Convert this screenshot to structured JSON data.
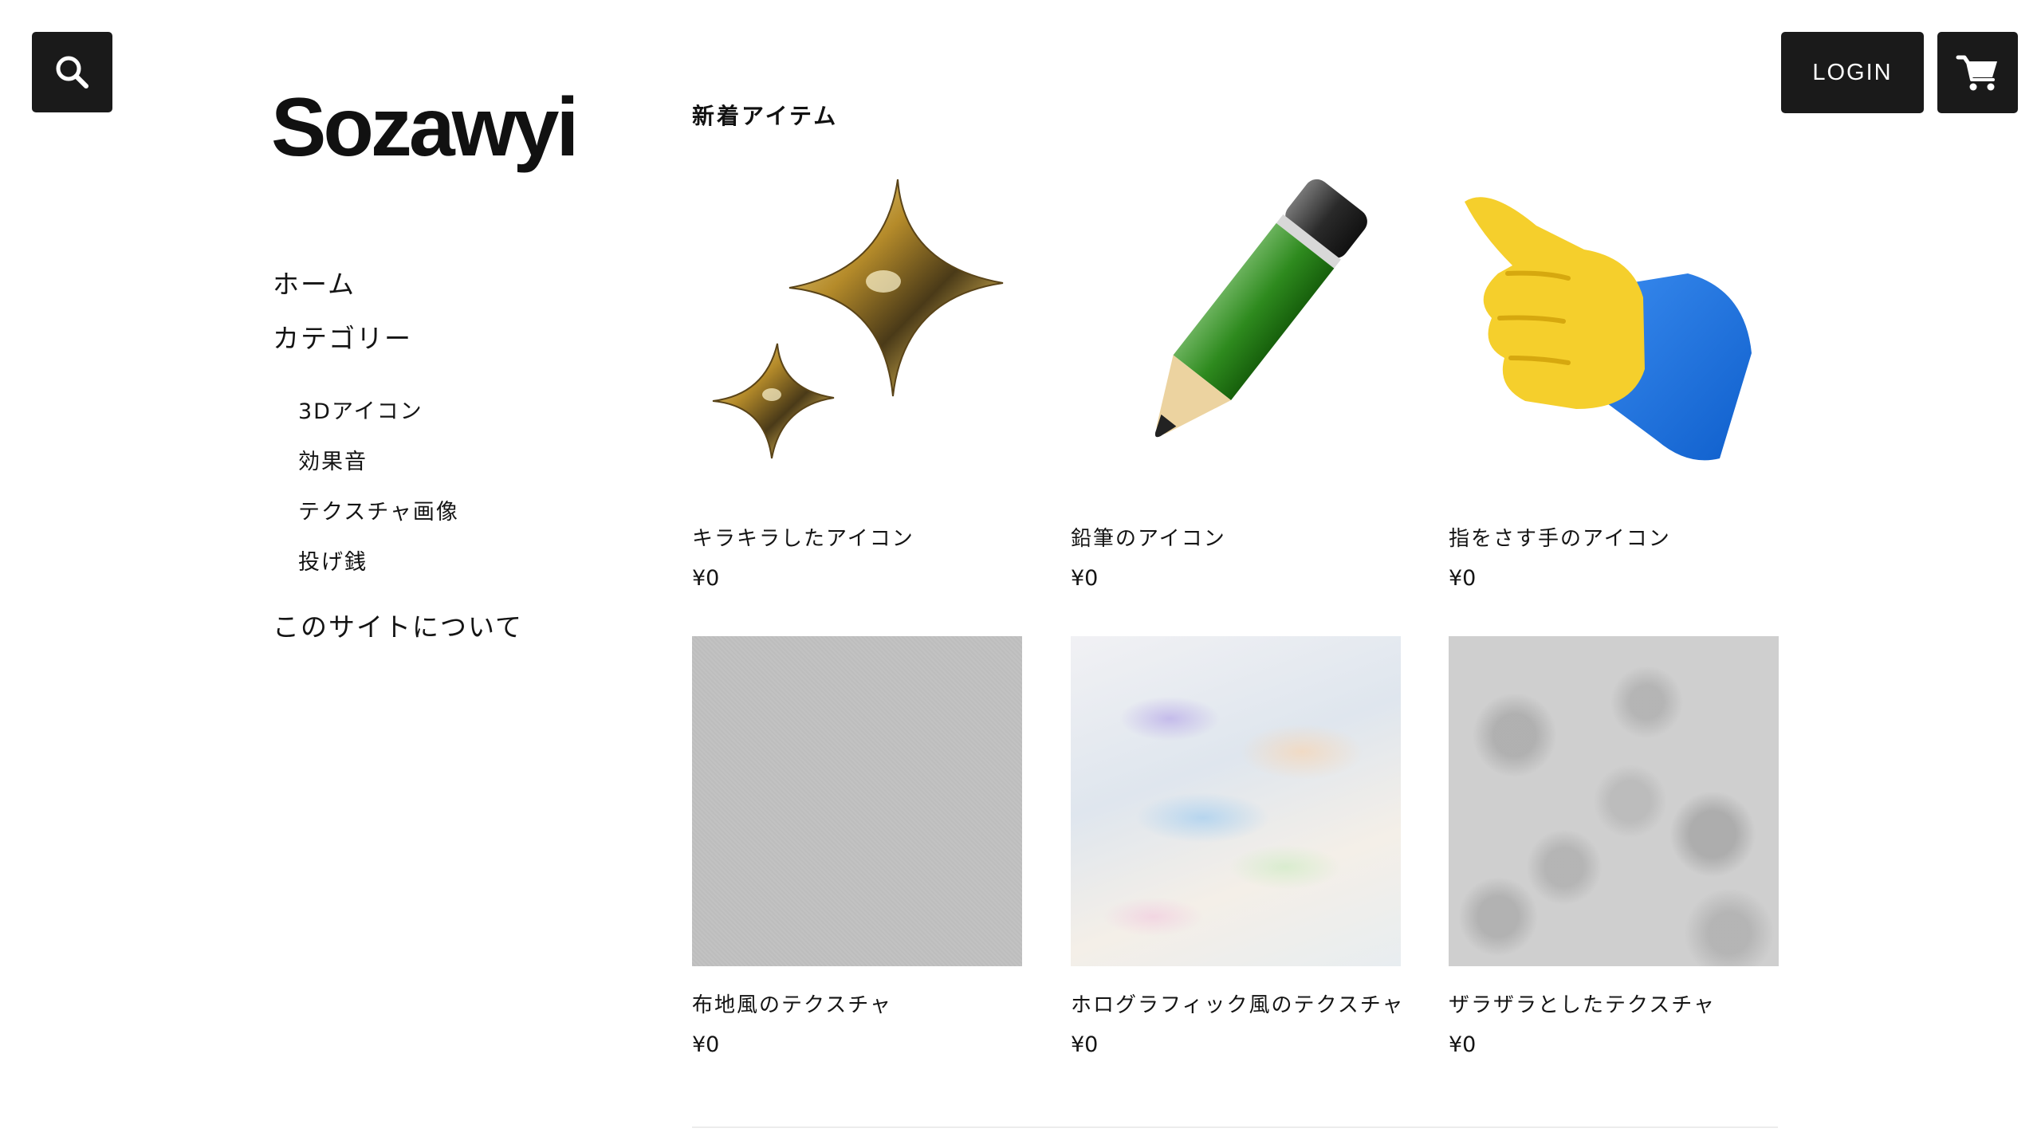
{
  "header": {
    "search_icon": "search-icon",
    "login_label": "LOGIN",
    "cart_icon": "cart-icon"
  },
  "brand": {
    "logo": "Sozawyi"
  },
  "nav": {
    "home": "ホーム",
    "category": "カテゴリー",
    "subcategories": [
      "3Dアイコン",
      "効果音",
      "テクスチャ画像",
      "投げ銭"
    ],
    "about": "このサイトについて"
  },
  "main": {
    "section_title": "新着アイテム",
    "products": [
      {
        "name": "キラキラしたアイコン",
        "price": "¥0",
        "image": "sparkles-3d-icon"
      },
      {
        "name": "鉛筆のアイコン",
        "price": "¥0",
        "image": "pencil-3d-icon"
      },
      {
        "name": "指をさす手のアイコン",
        "price": "¥0",
        "image": "pointing-hand-3d-icon"
      },
      {
        "name": "布地風のテクスチャ",
        "price": "¥0",
        "image": "fabric-texture"
      },
      {
        "name": "ホログラフィック風のテクスチャ",
        "price": "¥0",
        "image": "holographic-texture"
      },
      {
        "name": "ザラザラとしたテクスチャ",
        "price": "¥0",
        "image": "rough-texture"
      }
    ]
  },
  "colors": {
    "button_bg": "#1a1a1a",
    "text": "#141414",
    "background": "#ffffff"
  }
}
